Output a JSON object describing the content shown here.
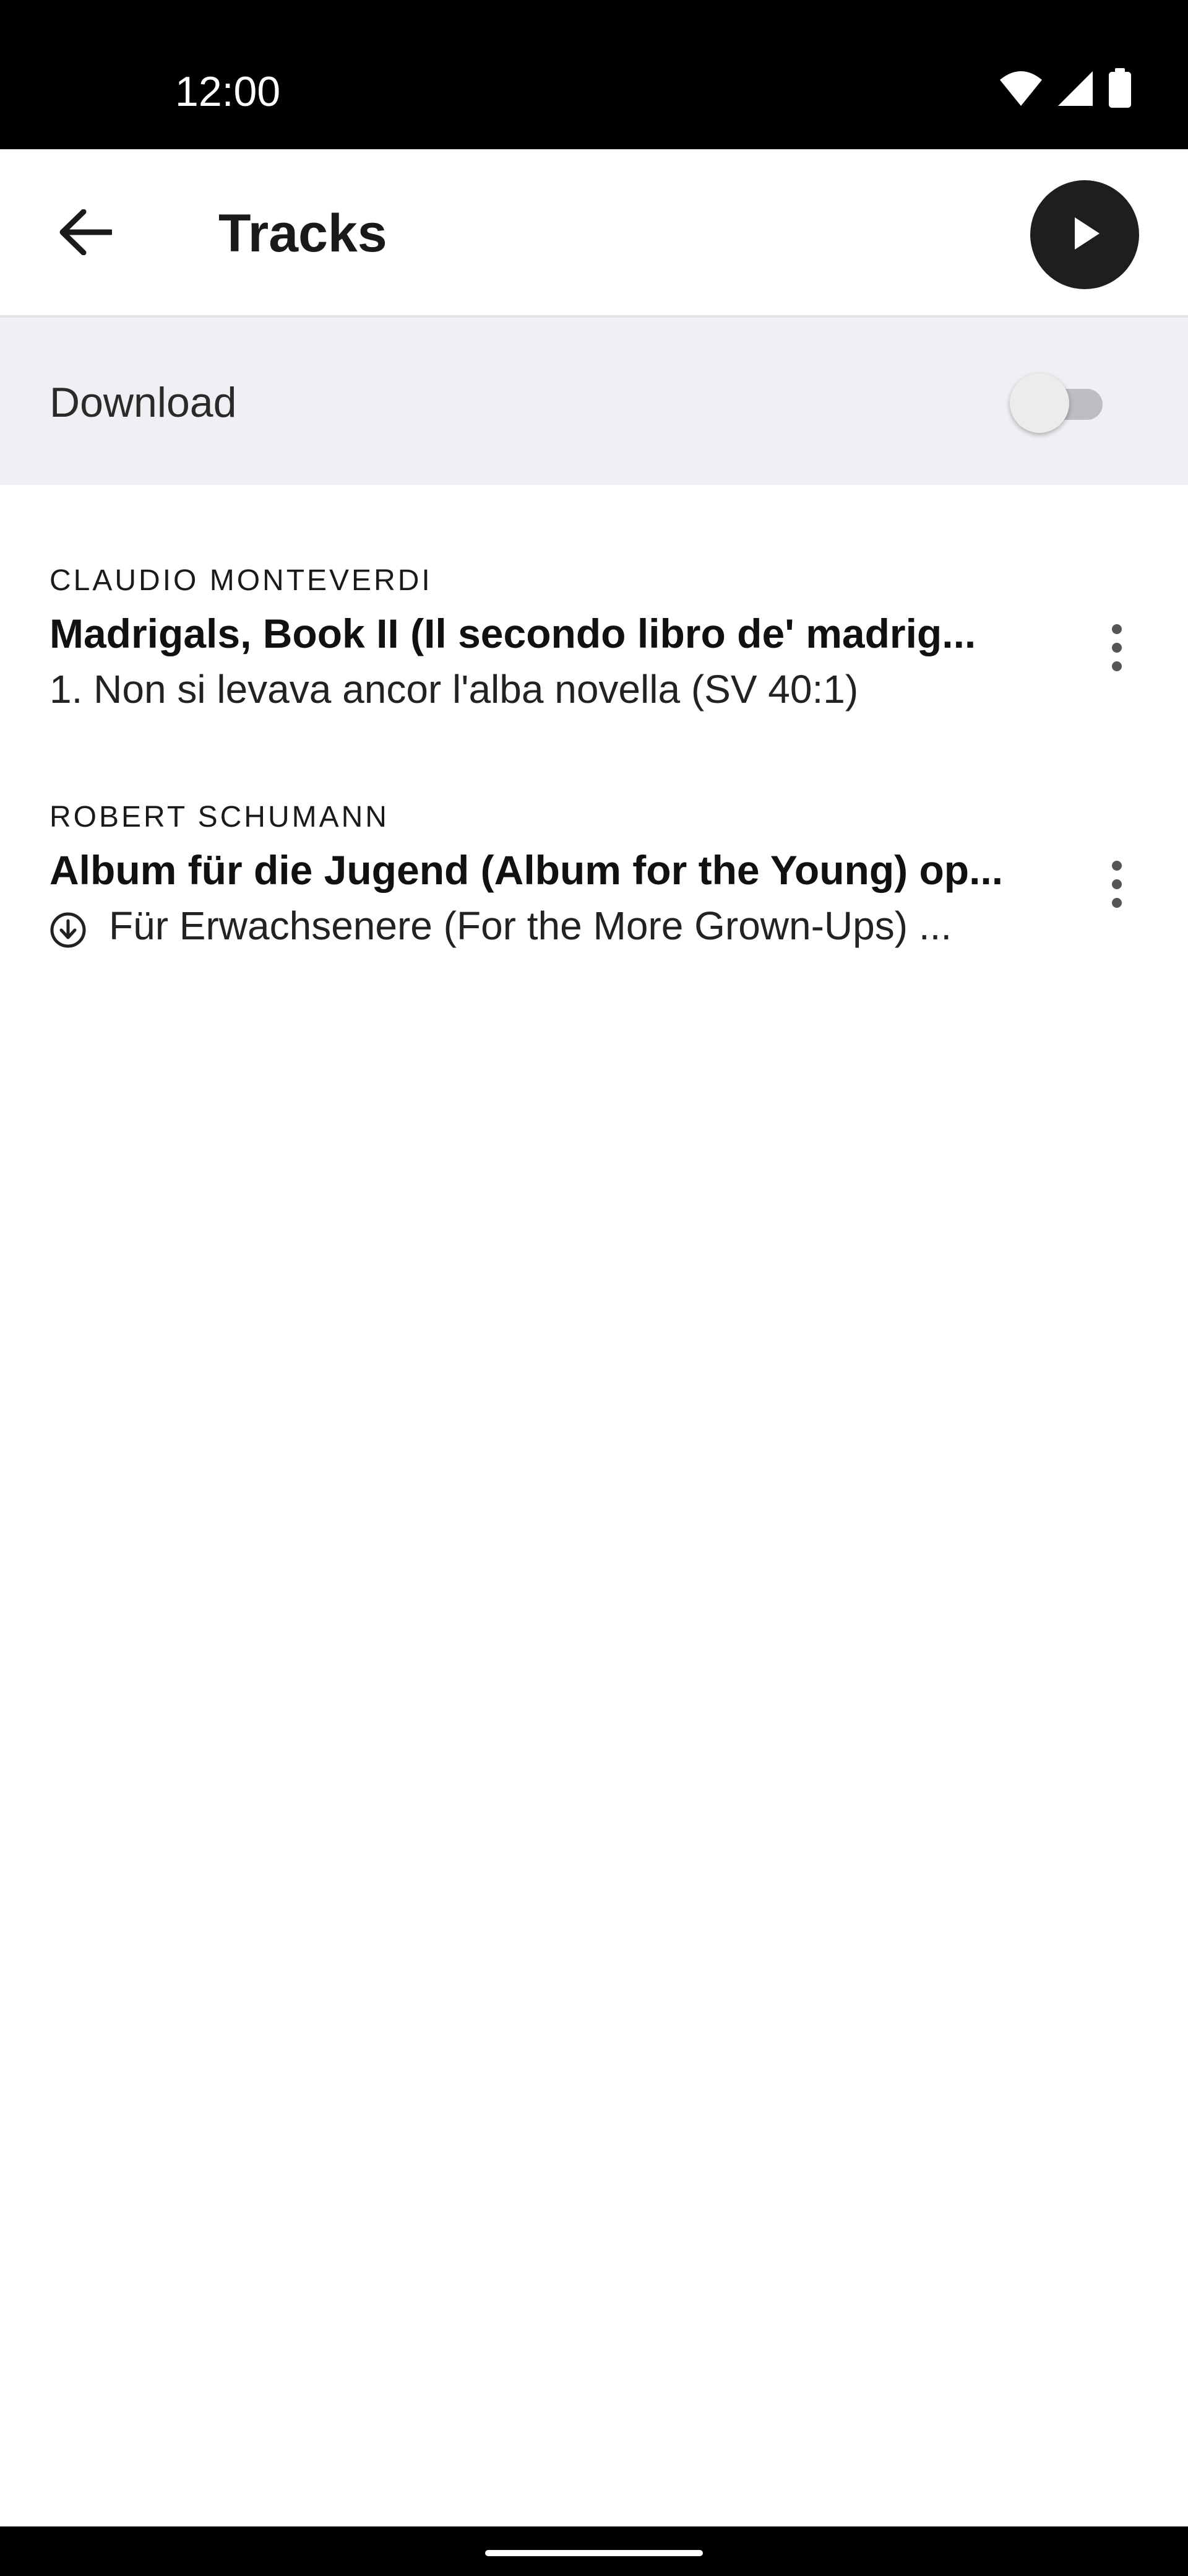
{
  "status_bar": {
    "time": "12:00",
    "icons": [
      "wifi-icon",
      "cellular-signal-icon",
      "battery-icon"
    ]
  },
  "app_bar": {
    "title": "Tracks",
    "back_icon": "arrow-left-icon",
    "play_icon": "play-icon"
  },
  "download": {
    "label": "Download",
    "enabled": false
  },
  "tracks": [
    {
      "composer": "CLAUDIO MONTEVERDI",
      "title": "Madrigals, Book II (Il secondo libro de' madrig...",
      "subtitle": "1. Non si levava ancor l'alba novella (SV 40:1)",
      "downloaded": false
    },
    {
      "composer": "ROBERT SCHUMANN",
      "title": "Album für die Jugend (Album for the Young) op...",
      "subtitle": "Für Erwachsenere (For the More Grown-Ups) ...",
      "downloaded": true
    }
  ],
  "colors": {
    "status_bar": "#000000",
    "download_row_bg": "#f0f0f4",
    "play_button": "#1e1e1e",
    "text": "#1a1a1a"
  }
}
